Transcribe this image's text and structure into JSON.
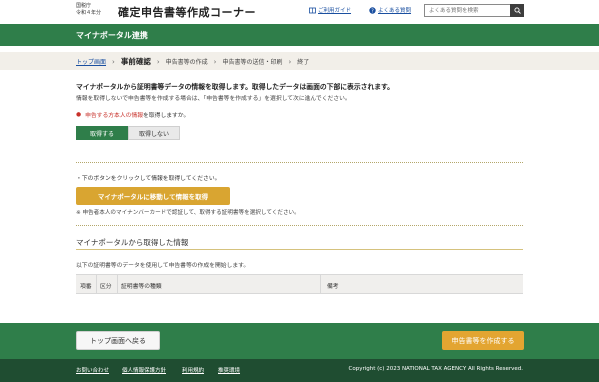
{
  "header": {
    "agency_line1": "国税庁",
    "agency_line2": "令和４年分",
    "site_title": "確定申告書等作成コーナー",
    "guide_link": "ご利用ガイド",
    "faq_link": "よくある質問",
    "search_placeholder": "よくある質問を検索"
  },
  "greenbar": {
    "title": "マイナポータル連携"
  },
  "steps": [
    {
      "label": "トップ画面",
      "state": "link"
    },
    {
      "label": "事前確認",
      "state": "current"
    },
    {
      "label": "申告書等の作成",
      "state": "normal"
    },
    {
      "label": "申告書等の送信・印刷",
      "state": "normal"
    },
    {
      "label": "終了",
      "state": "normal"
    }
  ],
  "main": {
    "heading": "マイナポータルから証明書等データの情報を取得します。取得したデータは画面の下部に表示されます。",
    "subtext": "情報を取得しないで申告書等を作成する場合は、「申告書等を作成する」を選択して次に進んでください。",
    "question_highlight": "申告する方本人の情報",
    "question_rest": "を取得しますか。",
    "toggle_yes": "取得する",
    "toggle_no": "取得しない",
    "instruction": "下のボタンをクリックして情報を取得してください。",
    "mp_button": "マイナポータルに移動して情報を取得",
    "note": "※ 申告者本人のマイナンバーカードで認証して、取得する証明書等を選択してください。"
  },
  "section": {
    "title": "マイナポータルから取得した情報",
    "subtext": "以下の証明書等のデータを使用して申告書等の作成を開始します。",
    "columns": [
      "項番",
      "区分",
      "証明書等の種類",
      "備考"
    ]
  },
  "footer": {
    "back_button": "トップ画面へ戻る",
    "create_button": "申告書等を作成する",
    "links": [
      "お問い合わせ",
      "個人情報保護方針",
      "利用規約",
      "推奨環境"
    ],
    "copyright": "Copyright (c) 2023 NATIONAL TAX AGENCY All Rights Reserved."
  },
  "colors": {
    "green": "#2f7e4a",
    "dark_green": "#1f4d31",
    "gold": "#d9a531",
    "orange": "#e3a531",
    "red": "#c8312a",
    "link": "#1a4fa0"
  }
}
